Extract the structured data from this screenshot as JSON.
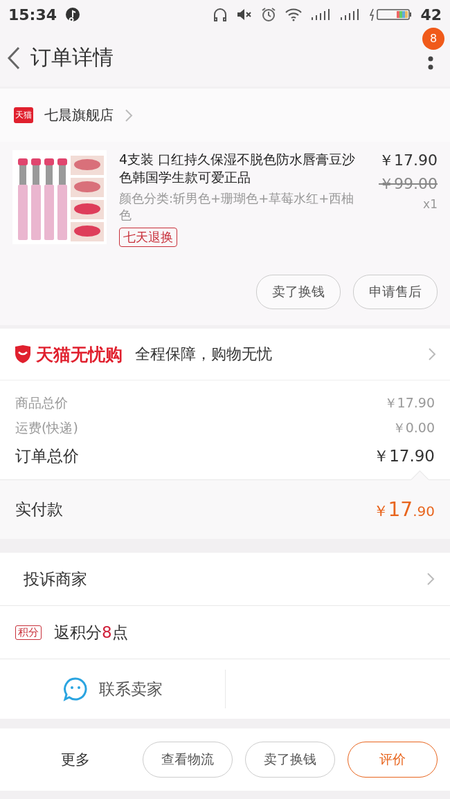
{
  "status_bar": {
    "time": "15:34",
    "battery": "42"
  },
  "header": {
    "title": "订单详情",
    "badge": "8"
  },
  "shop": {
    "badge": "天猫",
    "name": "七晨旗舰店"
  },
  "product": {
    "title": "4支装 口红持久保湿不脱色防水唇膏豆沙色韩国学生款可爱正品",
    "variant": "颜色分类:斩男色+珊瑚色+草莓水红+西柚色",
    "tag": "七天退换",
    "price": "￥17.90",
    "original_price": "￥99.00",
    "quantity": "x1",
    "buttons": [
      "卖了换钱",
      "申请售后"
    ]
  },
  "guarantee": {
    "brand": "天猫无忧购",
    "text": "全程保障，购物无忧"
  },
  "summary": [
    {
      "label": "商品总价",
      "value": "￥17.90",
      "kind": "minor"
    },
    {
      "label": "运费(快递)",
      "value": "￥0.00",
      "kind": "minor"
    },
    {
      "label": "订单总价",
      "value": "￥17.90",
      "kind": "major"
    }
  ],
  "paid": {
    "label": "实付款",
    "currency": "￥",
    "integer": "17",
    "decimal": ".90"
  },
  "complaint": {
    "label": "投诉商家"
  },
  "points": {
    "badge": "积分",
    "before": "返积分",
    "number": "8",
    "after": "点"
  },
  "contact": {
    "label": "联系卖家"
  },
  "bottom_bar": {
    "more": "更多",
    "buttons": [
      {
        "label": "查看物流",
        "primary": false
      },
      {
        "label": "卖了换钱",
        "primary": false
      },
      {
        "label": "评价",
        "primary": true
      }
    ]
  }
}
